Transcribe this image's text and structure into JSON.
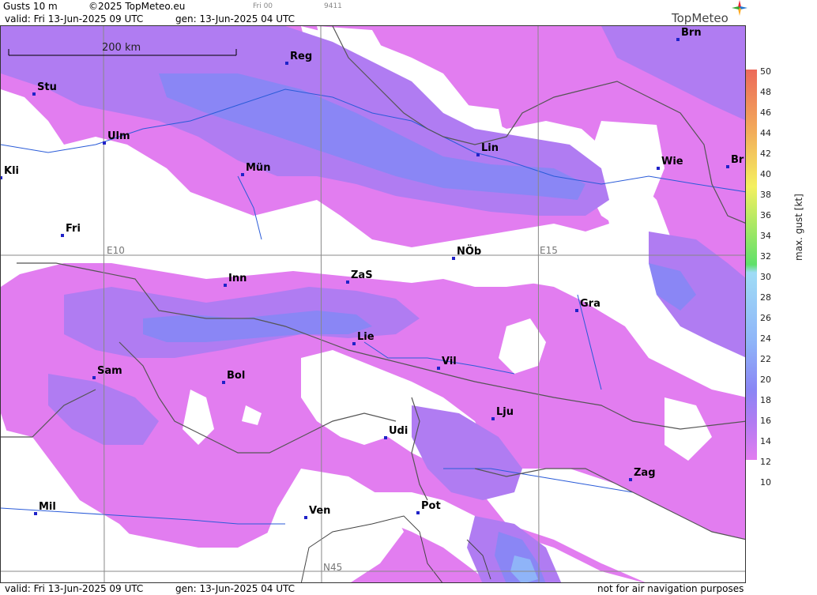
{
  "header": {
    "product": "Gusts 10 m",
    "copyright": "©2025 TopMeteo.eu",
    "run": "Fri 00",
    "code": "9411",
    "valid": "valid:  Fri  13-Jun-2025  09 UTC",
    "gen": "gen: 13-Jun-2025 04 UTC",
    "logo": "TopMeteo"
  },
  "footer": {
    "valid": "valid:  Fri  13-Jun-2025  09 UTC",
    "gen": "gen: 13-Jun-2025 04 UTC",
    "note": "not for air navigation purposes"
  },
  "map": {
    "scale_label": "200 km",
    "grid_labels": [
      "E10",
      "E15",
      "N45"
    ],
    "cities": [
      {
        "name": "Brn"
      },
      {
        "name": "Reg"
      },
      {
        "name": "Stu"
      },
      {
        "name": "Ulm"
      },
      {
        "name": "Kli"
      },
      {
        "name": "Mün"
      },
      {
        "name": "Lin"
      },
      {
        "name": "Wie"
      },
      {
        "name": "Br"
      },
      {
        "name": "Fri"
      },
      {
        "name": "NÖb"
      },
      {
        "name": "Inn"
      },
      {
        "name": "ZaS"
      },
      {
        "name": "Gra"
      },
      {
        "name": "Lie"
      },
      {
        "name": "Vil"
      },
      {
        "name": "Sam"
      },
      {
        "name": "Bol"
      },
      {
        "name": "Lju"
      },
      {
        "name": "Udi"
      },
      {
        "name": "Zag"
      },
      {
        "name": "Mil"
      },
      {
        "name": "Ven"
      },
      {
        "name": "Pot"
      }
    ]
  },
  "legend": {
    "unit": "max. gust  [kt]",
    "ticks": [
      "50",
      "48",
      "46",
      "44",
      "42",
      "40",
      "38",
      "36",
      "34",
      "32",
      "30",
      "28",
      "26",
      "24",
      "22",
      "20",
      "18",
      "16",
      "14",
      "12",
      "10"
    ],
    "colors": {
      "magenta": "#e27df0",
      "violet": "#b07cf2",
      "blue": "#8a86f5",
      "lightblue": "#8fb4f8",
      "cyan": "#9fdcf6",
      "green": "#5fe06a",
      "yellow": "#f4f060",
      "orange": "#f2a85a",
      "red": "#ec6a5a"
    }
  }
}
